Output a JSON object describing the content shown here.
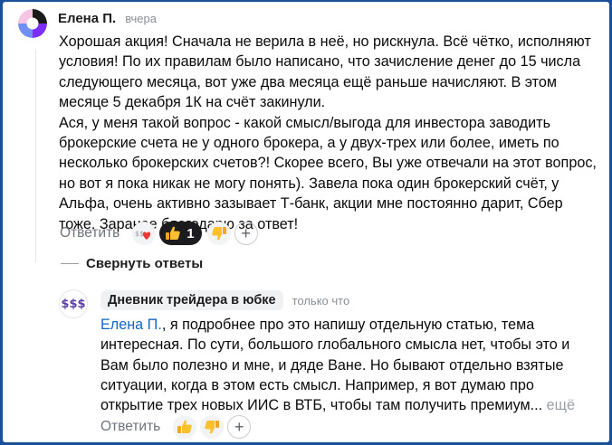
{
  "comment": {
    "author": "Елена П.",
    "time": "вчера",
    "paragraphs": [
      "Хорошая акция! Сначала не верила в неё, но рискнула. Всё чётко, исполняют условия! По их правилам было написано, что зачисление денег до 15 числа следующего месяца, вот уже два месяца ещё раньше начисляют. В этом месяце 5 декабря 1К на счёт закинули.",
      "Ася, у меня такой вопрос - какой смысл/выгода для инвестора заводить брокерские счета не у одного брокера, а у двух-трех или более, иметь по несколько брокерских счетов?! Скорее всего, Вы уже отвечали на этот вопрос, но вот я пока никак не могу понять). Завела пока один брокерский счёт, у Альфа, очень активно зазывает Т-банк, акции мне постоянно дарит, Сбер тоже. Заранее благодарю за ответ!"
    ],
    "reply_label": "Ответить",
    "like_count": "1",
    "reactions": [
      "money-heart",
      "thumbs-up",
      "thumbs-down"
    ]
  },
  "collapse_label": "Свернуть ответы",
  "reply": {
    "avatar_text": "$$$",
    "author": "Дневник трейдера в юбке",
    "time": "только что",
    "mention": "Елена П.",
    "text": ", я подробнее про это напишу отдельную статью, тема интересная. По сути, большого глобального смысла нет, чтобы это и Вам было полезно и мне, и дяде Ване. Но бывают отдельно взятые ситуации, когда в этом есть смысл. Например, я вот думаю про открытие трех новых ИИС в ВТБ, чтобы там получить премиум...",
    "more_label": "ещё",
    "reply_label": "Ответить",
    "reactions": [
      "thumbs-up",
      "thumbs-down"
    ]
  },
  "colors": {
    "accent_link": "#1565c0",
    "active_reaction_bg": "#1c1c1e",
    "page_border": "#1a4f9a"
  }
}
